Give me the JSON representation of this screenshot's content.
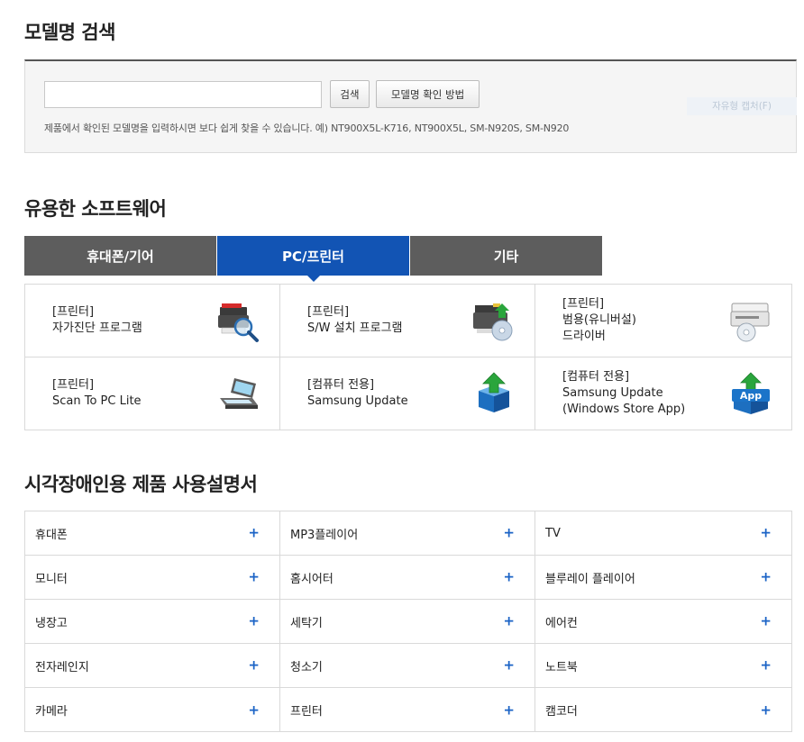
{
  "search_section": {
    "title": "모델명 검색",
    "input_value": "",
    "input_placeholder": "",
    "search_button": "검색",
    "howto_button": "모델명 확인 방법",
    "hint": "제품에서 확인된 모델명을 입력하시면 보다 쉽게 찾을 수 있습니다. 예) NT900X5L-K716, NT900X5L, SM-N920S, SM-N920",
    "ghost_overlay": "자유형 캡처(F)"
  },
  "software_section": {
    "title": "유용한 소프트웨어",
    "tabs": [
      {
        "label": "휴대폰/기어",
        "active": false
      },
      {
        "label": "PC/프린터",
        "active": true
      },
      {
        "label": "기타",
        "active": false
      }
    ],
    "items": [
      {
        "category": "[프린터]",
        "name": "자가진단 프로그램",
        "name2": "",
        "icon": "diagnostic-printer-icon"
      },
      {
        "category": "[프린터]",
        "name": "S/W 설치 프로그램",
        "name2": "",
        "icon": "printer-install-cd-icon"
      },
      {
        "category": "[프린터]",
        "name": "범용(유니버설)",
        "name2": "드라이버",
        "icon": "universal-driver-printer-icon"
      },
      {
        "category": "[프린터]",
        "name": "Scan To PC Lite",
        "name2": "",
        "icon": "scanner-icon"
      },
      {
        "category": "[컴퓨터 전용]",
        "name": "Samsung Update",
        "name2": "",
        "icon": "update-box-icon"
      },
      {
        "category": "[컴퓨터 전용]",
        "name": "Samsung Update",
        "name2": "(Windows Store App)",
        "icon": "app-update-box-icon"
      }
    ]
  },
  "manual_section": {
    "title": "시각장애인용 제품 사용설명서",
    "plus_symbol": "+",
    "items": [
      "휴대폰",
      "MP3플레이어",
      "TV",
      "모니터",
      "홈시어터",
      "블루레이 플레이어",
      "냉장고",
      "세탁기",
      "에어컨",
      "전자레인지",
      "청소기",
      "노트북",
      "카메라",
      "프린터",
      "캠코더"
    ]
  },
  "colors": {
    "tab_active": "#1254b4",
    "tab_inactive": "#5d5d5d",
    "plus": "#1b63c6",
    "icon_blue": "#1b74c9",
    "icon_green": "#2aa53c"
  }
}
